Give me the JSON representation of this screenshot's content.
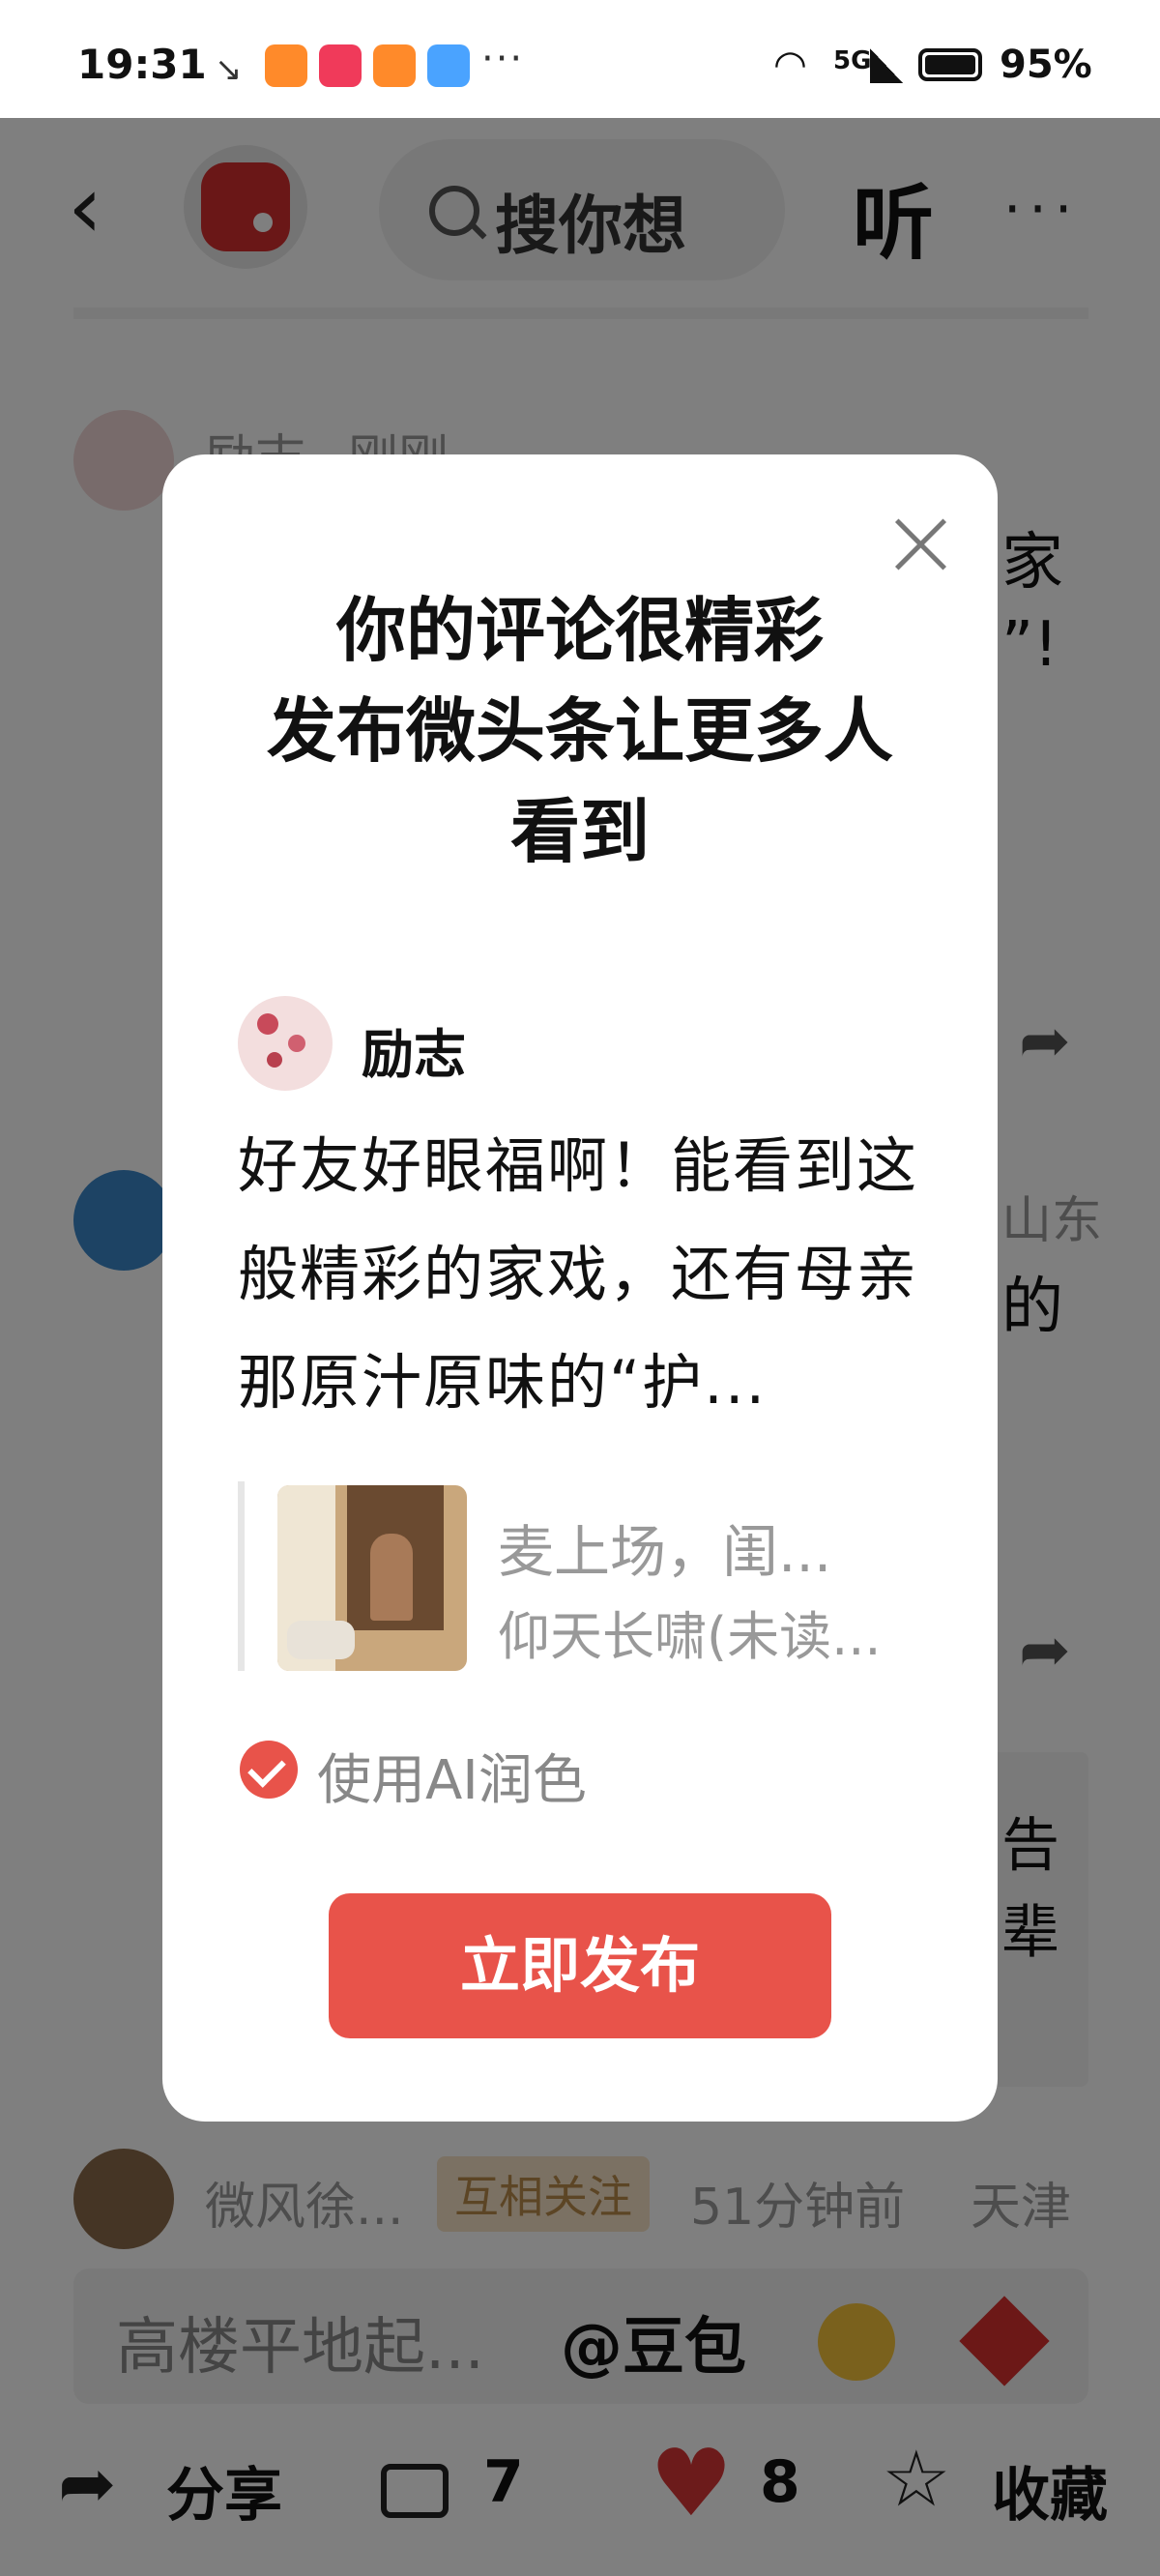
{
  "status_bar": {
    "time": "19:31",
    "network": "5G",
    "battery": "95%",
    "more": "···"
  },
  "header": {
    "back_glyph": "‹",
    "search_placeholder": "搜你想",
    "listen_label": "听",
    "more_glyph": "···"
  },
  "feed": {
    "comment1": {
      "author": "励志",
      "time": "刚刚",
      "partial_right1": "家",
      "partial_right2": "”!"
    },
    "comment2": {
      "partial_right1": "山东",
      "partial_right2": "的"
    },
    "comment3": {
      "partial_right1": "告",
      "partial_right2": "辈"
    },
    "comment4": {
      "author": "微风徐...",
      "badge": "互相关注",
      "time": "51分钟前",
      "location": "天津"
    }
  },
  "input_bar": {
    "placeholder": "高楼平地起...",
    "mention": "@豆包"
  },
  "bottom_bar": {
    "share_label": "分享",
    "comment_count": "7",
    "like_count": "8",
    "favorite_label": "收藏"
  },
  "modal": {
    "title_line1": "你的评论很精彩",
    "title_line2": "发布微头条让更多人",
    "title_line3": "看到",
    "author": "励志",
    "body": "好友好眼福啊！能看到这般精彩的家戏，还有母亲那原汁原味的“护...",
    "quote_title": "麦上场，闺...",
    "quote_author": "仰天长啸(未读...",
    "ai_label": "使用AI润色",
    "ai_checked": true,
    "publish_label": "立即发布"
  },
  "colors": {
    "accent": "#e8534a",
    "heart": "#d93636",
    "badge_bg": "#f6e3c7",
    "badge_text": "#b98a4a"
  }
}
